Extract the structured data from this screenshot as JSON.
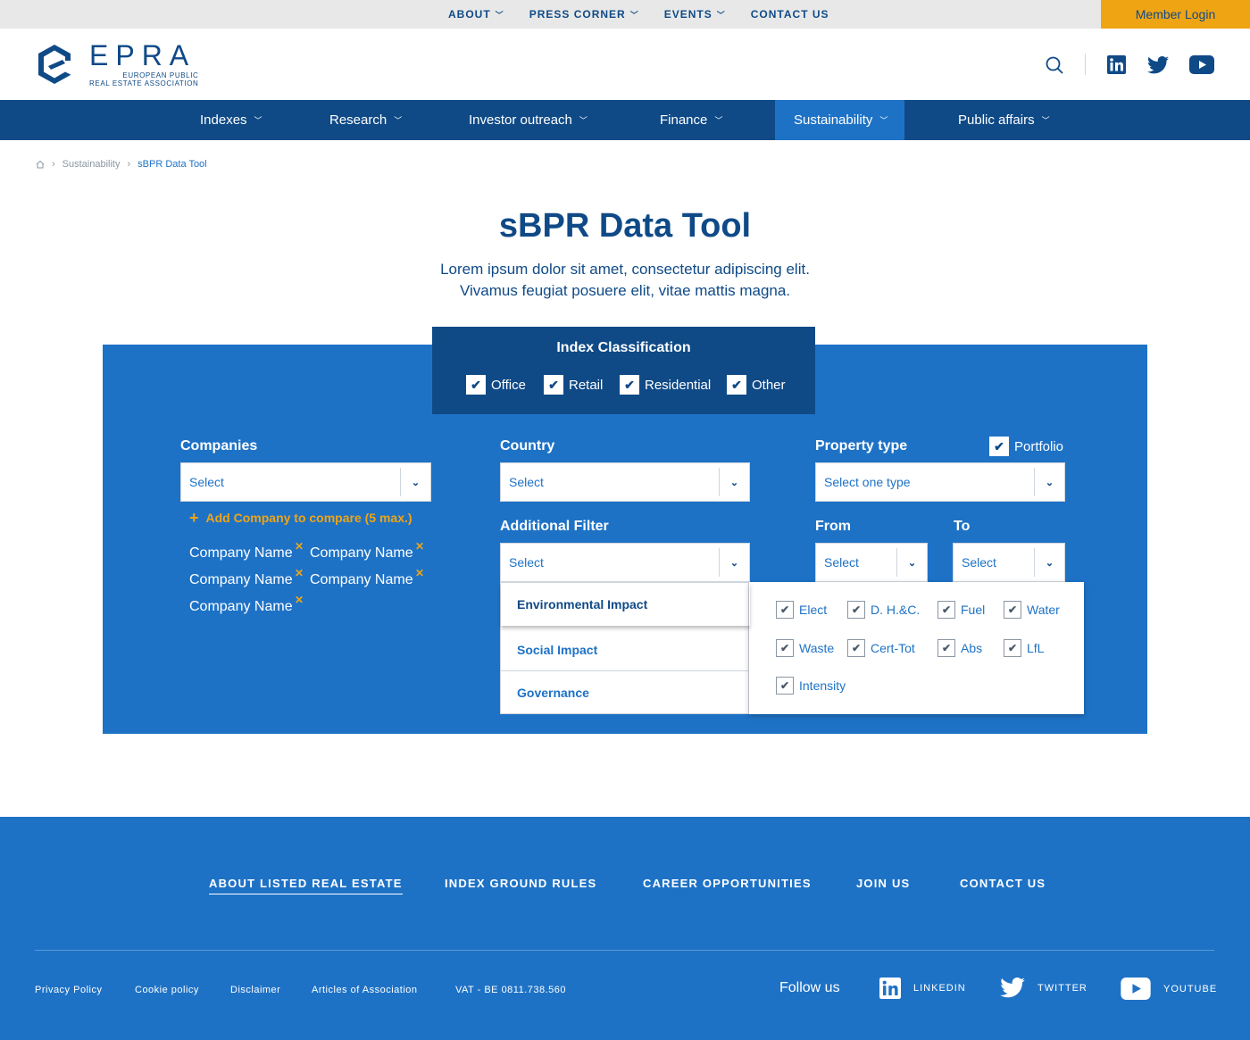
{
  "utility_nav": {
    "items": [
      {
        "label": "ABOUT",
        "has_dropdown": true
      },
      {
        "label": "PRESS CORNER",
        "has_dropdown": true
      },
      {
        "label": "EVENTS",
        "has_dropdown": true
      },
      {
        "label": "CONTACT US",
        "has_dropdown": false
      }
    ],
    "member_login": "Member Login"
  },
  "brand": {
    "name": "EPRA",
    "tagline_line1": "EUROPEAN PUBLIC",
    "tagline_line2": "REAL ESTATE ASSOCIATION"
  },
  "main_nav": {
    "items": [
      {
        "label": "Indexes"
      },
      {
        "label": "Research"
      },
      {
        "label": "Investor outreach"
      },
      {
        "label": "Finance"
      },
      {
        "label": "Sustainability",
        "active": true
      },
      {
        "label": "Public affairs"
      }
    ]
  },
  "breadcrumb": {
    "items": [
      "Sustainability",
      "sBPR Data Tool"
    ]
  },
  "page": {
    "title": "sBPR Data Tool",
    "intro_line1": "Lorem ipsum dolor sit amet, consectetur adipiscing elit.",
    "intro_line2": "Vivamus feugiat posuere elit, vitae mattis magna."
  },
  "index_classification": {
    "title": "Index Classification",
    "options": [
      {
        "label": "Office",
        "checked": true
      },
      {
        "label": "Retail",
        "checked": true
      },
      {
        "label": "Residential",
        "checked": true
      },
      {
        "label": "Other",
        "checked": true
      }
    ]
  },
  "filters": {
    "companies": {
      "label": "Companies",
      "value": "Select"
    },
    "add_company": "Add Company to compare (5 max.)",
    "company_chips": [
      "Company Name",
      "Company Name",
      "Company Name",
      "Company Name",
      "Company Name"
    ],
    "country": {
      "label": "Country",
      "value": "Select"
    },
    "property_type": {
      "label": "Property type",
      "value": "Select one type"
    },
    "portfolio": {
      "label": "Portfolio",
      "checked": true
    },
    "additional_filter": {
      "label": "Additional Filter",
      "value": "Select"
    },
    "from": {
      "label": "From",
      "value": "Select"
    },
    "to": {
      "label": "To",
      "value": "Select"
    }
  },
  "dropdown": {
    "categories": [
      {
        "label": "Environmental Impact",
        "active": true
      },
      {
        "label": "Social Impact"
      },
      {
        "label": "Governance"
      }
    ],
    "options": [
      {
        "label": "Elect",
        "checked": true
      },
      {
        "label": "D. H.&C.",
        "checked": true
      },
      {
        "label": "Fuel",
        "checked": true
      },
      {
        "label": "Water",
        "checked": true
      },
      {
        "label": "Waste",
        "checked": true
      },
      {
        "label": "Cert-Tot",
        "checked": true
      },
      {
        "label": "Abs",
        "checked": true
      },
      {
        "label": "LfL",
        "checked": true
      },
      {
        "label": "Intensity",
        "checked": true
      }
    ]
  },
  "footer": {
    "links": [
      "ABOUT LISTED REAL ESTATE",
      "INDEX GROUND RULES",
      "CAREER OPPORTUNITIES",
      "JOIN US",
      "CONTACT US"
    ],
    "legal": [
      "Privacy Policy",
      "Cookie policy",
      "Disclaimer",
      "Articles of Association",
      "VAT - BE 0811.738.560"
    ],
    "follow_label": "Follow us",
    "social": [
      "LINKEDIN",
      "TWITTER",
      "YOUTUBE"
    ]
  },
  "colors": {
    "navy": "#0f4a87",
    "blue": "#1e72c6",
    "accent": "#efa414"
  }
}
